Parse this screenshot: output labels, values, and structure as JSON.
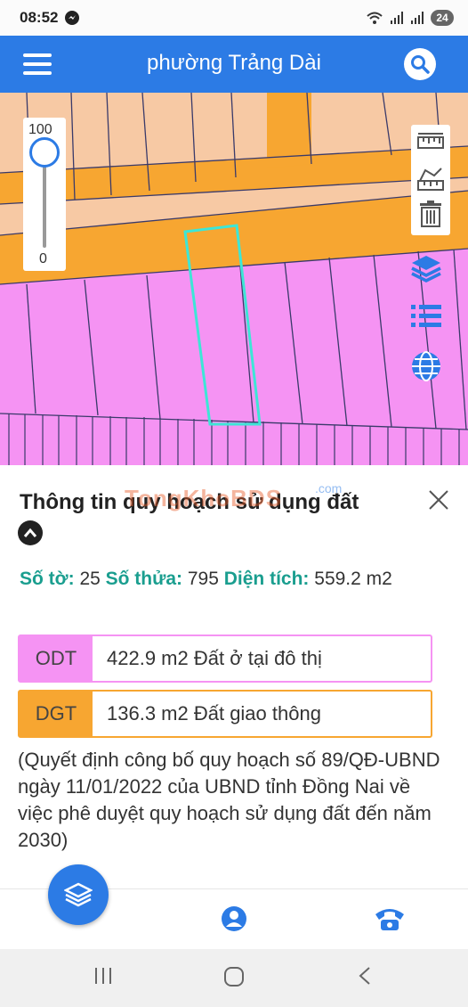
{
  "status_bar": {
    "time": "08:52",
    "battery": "24"
  },
  "app_bar": {
    "title": "phường Trảng Dài"
  },
  "map": {
    "zoom_max_label": "100",
    "zoom_min_label": "0",
    "zoom_value": 100,
    "colors": {
      "residential": "#f593f3",
      "transport": "#f7a631",
      "upper_zone": "#f7c9a4",
      "selected_outline": "#3de6d6"
    }
  },
  "panel": {
    "title": "Thông tin quy hoạch sử dụng đất",
    "watermark": "TongKhoBDS",
    "watermark_suffix": ".com",
    "parcel": {
      "sheet_label": "Số tờ:",
      "sheet_value": "25",
      "lot_label": "Số thửa:",
      "lot_value": "795",
      "area_label": "Diện tích:",
      "area_value": "559.2 m2"
    },
    "zones": [
      {
        "code": "ODT",
        "description": "422.9 m2 Đất ở tại đô thị",
        "color": "#f593f3"
      },
      {
        "code": "DGT",
        "description": "136.3 m2 Đất giao thông",
        "color": "#f7a631"
      }
    ],
    "decision": "(Quyết định công bố quy hoạch số 89/QĐ-UBND ngày 11/01/2022 của UBND tỉnh Đồng Nai về việc phê duyệt quy hoạch sử dụng đất đến năm 2030)"
  }
}
